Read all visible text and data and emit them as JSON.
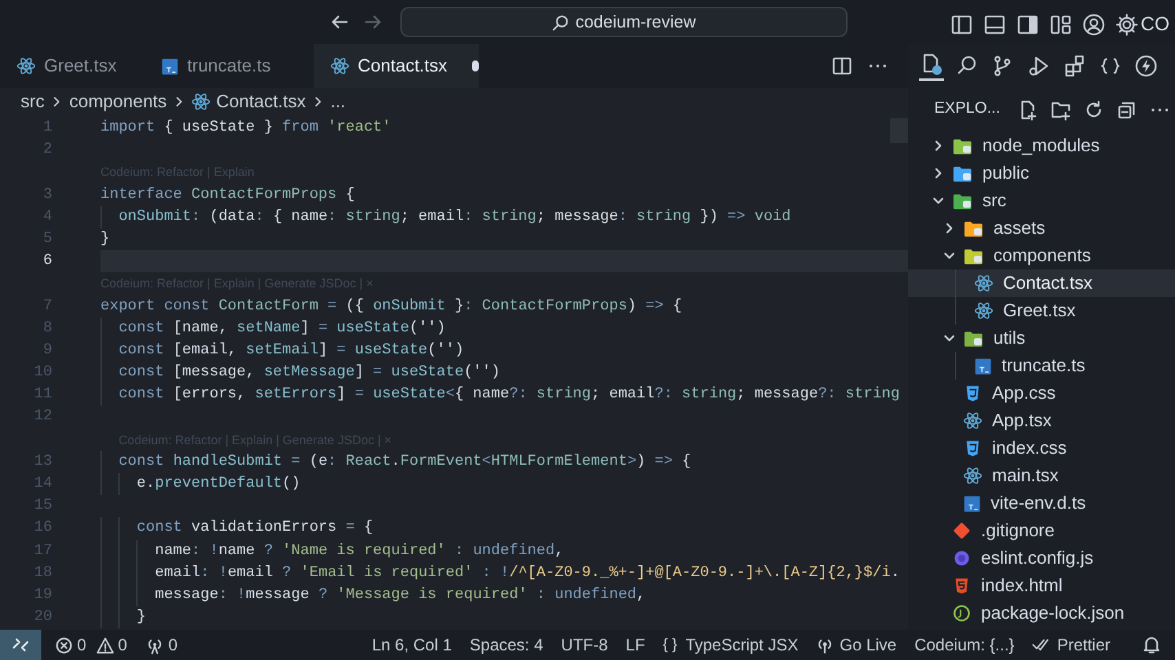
{
  "title_bar": {
    "search": "codeium-review",
    "account": "CO"
  },
  "tabs": [
    {
      "label": "Greet.tsx",
      "kind": "react",
      "selected": false,
      "modified": false
    },
    {
      "label": "truncate.ts",
      "kind": "ts",
      "selected": false,
      "modified": false
    },
    {
      "label": "Contact.tsx",
      "kind": "react",
      "selected": true,
      "modified": true
    }
  ],
  "breadcrumb": [
    {
      "label": "src",
      "kind": "folder"
    },
    {
      "label": "components",
      "kind": "folder"
    },
    {
      "label": "Contact.tsx",
      "kind": "react"
    },
    {
      "label": "...",
      "kind": "more"
    }
  ],
  "code": [
    {
      "kind": "line",
      "number": "1",
      "current": false,
      "tokens": [
        {
          "kind": "keyword",
          "text": "import"
        },
        {
          "kind": "plain",
          "text": " { useState } "
        },
        {
          "kind": "keyword",
          "text": "from"
        },
        {
          "kind": "string",
          "text": " 'react'"
        }
      ]
    },
    {
      "kind": "line",
      "number": "2",
      "current": false
    },
    {
      "kind": "lens",
      "text": "Codeium: Refactor | Explain"
    },
    {
      "kind": "line",
      "number": "3",
      "current": false,
      "tokens": [
        {
          "kind": "keyword",
          "text": "interface "
        },
        {
          "kind": "type",
          "text": "ContactFormProps"
        },
        {
          "kind": "plain",
          "text": " {"
        }
      ]
    },
    {
      "kind": "line",
      "number": "4",
      "current": false,
      "tokens": [
        {
          "kind": "func",
          "text": "  onSubmit"
        },
        {
          "kind": "op",
          "text": ": "
        },
        {
          "kind": "plain",
          "text": "(data"
        },
        {
          "kind": "op",
          "text": ": "
        },
        {
          "kind": "plain",
          "text": "{ name"
        },
        {
          "kind": "op",
          "text": ": "
        },
        {
          "kind": "type",
          "text": "string"
        },
        {
          "kind": "plain",
          "text": "; email"
        },
        {
          "kind": "op",
          "text": ": "
        },
        {
          "kind": "type",
          "text": "string"
        },
        {
          "kind": "plain",
          "text": "; message"
        },
        {
          "kind": "op",
          "text": ": "
        },
        {
          "kind": "type",
          "text": "string"
        },
        {
          "kind": "plain",
          "text": " }) "
        },
        {
          "kind": "op",
          "text": "=> "
        },
        {
          "kind": "type",
          "text": "void"
        }
      ]
    },
    {
      "kind": "line",
      "number": "5",
      "current": false,
      "tokens": [
        {
          "kind": "plain",
          "text": "}"
        }
      ]
    },
    {
      "kind": "line",
      "number": "6",
      "current": true
    },
    {
      "kind": "lens",
      "text": "Codeium: Refactor | Explain | Generate JSDoc | ×"
    },
    {
      "kind": "line",
      "number": "7",
      "current": false,
      "tokens": [
        {
          "kind": "keyword",
          "text": "export const "
        },
        {
          "kind": "type",
          "text": "ContactForm"
        },
        {
          "kind": "op",
          "text": " = "
        },
        {
          "kind": "plain",
          "text": "({ "
        },
        {
          "kind": "func",
          "text": "onSubmit"
        },
        {
          "kind": "plain",
          "text": " }"
        },
        {
          "kind": "op",
          "text": ": "
        },
        {
          "kind": "type",
          "text": "ContactFormProps"
        },
        {
          "kind": "plain",
          "text": ") "
        },
        {
          "kind": "op",
          "text": "=> "
        },
        {
          "kind": "plain",
          "text": "{"
        }
      ]
    },
    {
      "kind": "line",
      "number": "8",
      "current": false,
      "tokens": [
        {
          "kind": "keyword",
          "text": "  const "
        },
        {
          "kind": "plain",
          "text": "[name, "
        },
        {
          "kind": "func",
          "text": "setName"
        },
        {
          "kind": "plain",
          "text": "] "
        },
        {
          "kind": "op",
          "text": "= "
        },
        {
          "kind": "func",
          "text": "useState"
        },
        {
          "kind": "plain",
          "text": "('')"
        }
      ]
    },
    {
      "kind": "line",
      "number": "9",
      "current": false,
      "tokens": [
        {
          "kind": "keyword",
          "text": "  const "
        },
        {
          "kind": "plain",
          "text": "[email, "
        },
        {
          "kind": "func",
          "text": "setEmail"
        },
        {
          "kind": "plain",
          "text": "] "
        },
        {
          "kind": "op",
          "text": "= "
        },
        {
          "kind": "func",
          "text": "useState"
        },
        {
          "kind": "plain",
          "text": "('')"
        }
      ]
    },
    {
      "kind": "line",
      "number": "10",
      "current": false,
      "tokens": [
        {
          "kind": "keyword",
          "text": "  const "
        },
        {
          "kind": "plain",
          "text": "[message, "
        },
        {
          "kind": "func",
          "text": "setMessage"
        },
        {
          "kind": "plain",
          "text": "] "
        },
        {
          "kind": "op",
          "text": "= "
        },
        {
          "kind": "func",
          "text": "useState"
        },
        {
          "kind": "plain",
          "text": "('')"
        }
      ]
    },
    {
      "kind": "line",
      "number": "11",
      "current": false,
      "tokens": [
        {
          "kind": "keyword",
          "text": "  const "
        },
        {
          "kind": "plain",
          "text": "[errors, "
        },
        {
          "kind": "func",
          "text": "setErrors"
        },
        {
          "kind": "plain",
          "text": "] "
        },
        {
          "kind": "op",
          "text": "= "
        },
        {
          "kind": "func",
          "text": "useState"
        },
        {
          "kind": "op",
          "text": "<"
        },
        {
          "kind": "plain",
          "text": "{ name"
        },
        {
          "kind": "op",
          "text": "?: "
        },
        {
          "kind": "type",
          "text": "string"
        },
        {
          "kind": "plain",
          "text": "; email"
        },
        {
          "kind": "op",
          "text": "?: "
        },
        {
          "kind": "type",
          "text": "string"
        },
        {
          "kind": "plain",
          "text": "; message"
        },
        {
          "kind": "op",
          "text": "?: "
        },
        {
          "kind": "type",
          "text": "string"
        }
      ]
    },
    {
      "kind": "line",
      "number": "12",
      "current": false
    },
    {
      "kind": "lens",
      "text": "Codeium: Refactor | Explain | Generate JSDoc | ×"
    },
    {
      "kind": "line",
      "number": "13",
      "current": false,
      "tokens": [
        {
          "kind": "keyword",
          "text": "  const "
        },
        {
          "kind": "func",
          "text": "handleSubmit"
        },
        {
          "kind": "op",
          "text": " = "
        },
        {
          "kind": "plain",
          "text": "(e"
        },
        {
          "kind": "op",
          "text": ": "
        },
        {
          "kind": "type",
          "text": "React"
        },
        {
          "kind": "plain",
          "text": "."
        },
        {
          "kind": "type",
          "text": "FormEvent"
        },
        {
          "kind": "op",
          "text": "<"
        },
        {
          "kind": "type",
          "text": "HTMLFormElement"
        },
        {
          "kind": "op",
          "text": ">"
        },
        {
          "kind": "plain",
          "text": ") "
        },
        {
          "kind": "op",
          "text": "=> "
        },
        {
          "kind": "plain",
          "text": "{"
        }
      ]
    },
    {
      "kind": "line",
      "number": "14",
      "current": false,
      "tokens": [
        {
          "kind": "plain",
          "text": "    e."
        },
        {
          "kind": "func",
          "text": "preventDefault"
        },
        {
          "kind": "plain",
          "text": "()"
        }
      ]
    },
    {
      "kind": "line",
      "number": "15",
      "current": false
    },
    {
      "kind": "line",
      "number": "16",
      "current": false,
      "tokens": [
        {
          "kind": "keyword",
          "text": "    const "
        },
        {
          "kind": "plain",
          "text": "validationErrors"
        },
        {
          "kind": "op",
          "text": " = "
        },
        {
          "kind": "plain",
          "text": "{"
        }
      ]
    },
    {
      "kind": "line",
      "number": "17",
      "current": false,
      "tokens": [
        {
          "kind": "plain",
          "text": "      name"
        },
        {
          "kind": "op",
          "text": ": !"
        },
        {
          "kind": "plain",
          "text": "name"
        },
        {
          "kind": "op",
          "text": " ? "
        },
        {
          "kind": "string",
          "text": "'Name is required'"
        },
        {
          "kind": "op",
          "text": " : "
        },
        {
          "kind": "keyword",
          "text": "undefined"
        },
        {
          "kind": "plain",
          "text": ","
        }
      ]
    },
    {
      "kind": "line",
      "number": "18",
      "current": false,
      "tokens": [
        {
          "kind": "plain",
          "text": "      email"
        },
        {
          "kind": "op",
          "text": ": !"
        },
        {
          "kind": "plain",
          "text": "email"
        },
        {
          "kind": "op",
          "text": " ? "
        },
        {
          "kind": "string",
          "text": "'Email is required'"
        },
        {
          "kind": "op",
          "text": " : !"
        },
        {
          "kind": "regex",
          "text": "/^[A-Z0-9._%+-]+@[A-Z0-9.-]+\\.[A-Z]{2,}$/i"
        },
        {
          "kind": "plain",
          "text": "."
        }
      ]
    },
    {
      "kind": "line",
      "number": "19",
      "current": false,
      "tokens": [
        {
          "kind": "plain",
          "text": "      message"
        },
        {
          "kind": "op",
          "text": ": !"
        },
        {
          "kind": "plain",
          "text": "message"
        },
        {
          "kind": "op",
          "text": " ? "
        },
        {
          "kind": "string",
          "text": "'Message is required'"
        },
        {
          "kind": "op",
          "text": " : "
        },
        {
          "kind": "keyword",
          "text": "undefined"
        },
        {
          "kind": "plain",
          "text": ","
        }
      ]
    },
    {
      "kind": "line",
      "number": "20",
      "current": false,
      "tokens": [
        {
          "kind": "plain",
          "text": "    }"
        }
      ]
    }
  ],
  "explorer": {
    "title": "EXPLO...",
    "tree": [
      {
        "name": "node_modules",
        "kind": "node",
        "expanded": false,
        "selected": false
      },
      {
        "name": "public",
        "kind": "public",
        "expanded": false,
        "selected": false
      },
      {
        "name": "src",
        "kind": "src",
        "expanded": true,
        "selected": false,
        "children": [
          {
            "name": "assets",
            "kind": "assets",
            "expanded": false,
            "selected": false
          },
          {
            "name": "components",
            "kind": "components",
            "expanded": true,
            "selected": false,
            "children": [
              {
                "name": "Contact.tsx",
                "kind": "react",
                "selected": true
              },
              {
                "name": "Greet.tsx",
                "kind": "react",
                "selected": false
              }
            ]
          },
          {
            "name": "utils",
            "kind": "utils",
            "expanded": true,
            "selected": false,
            "children": [
              {
                "name": "truncate.ts",
                "kind": "ts",
                "selected": false
              }
            ]
          },
          {
            "name": "App.css",
            "kind": "css",
            "selected": false
          },
          {
            "name": "App.tsx",
            "kind": "react",
            "selected": false
          },
          {
            "name": "index.css",
            "kind": "css",
            "selected": false
          },
          {
            "name": "main.tsx",
            "kind": "react",
            "selected": false
          },
          {
            "name": "vite-env.d.ts",
            "kind": "ts",
            "selected": false
          }
        ]
      },
      {
        "name": ".gitignore",
        "kind": "git",
        "selected": false
      },
      {
        "name": "eslint.config.js",
        "kind": "eslint",
        "selected": false
      },
      {
        "name": "index.html",
        "kind": "html",
        "selected": false
      },
      {
        "name": "package-lock.json",
        "kind": "json",
        "selected": false
      }
    ]
  },
  "status_bar": {
    "errors": "0",
    "warnings": "0",
    "ports": "0",
    "items": [
      "Ln 6, Col 1",
      "Spaces: 4",
      "UTF-8",
      "LF"
    ],
    "language_icon": "{ }",
    "language": "TypeScript JSX",
    "live": "Go Live",
    "codeium": "Codeium: {...}",
    "prettier": "Prettier"
  }
}
